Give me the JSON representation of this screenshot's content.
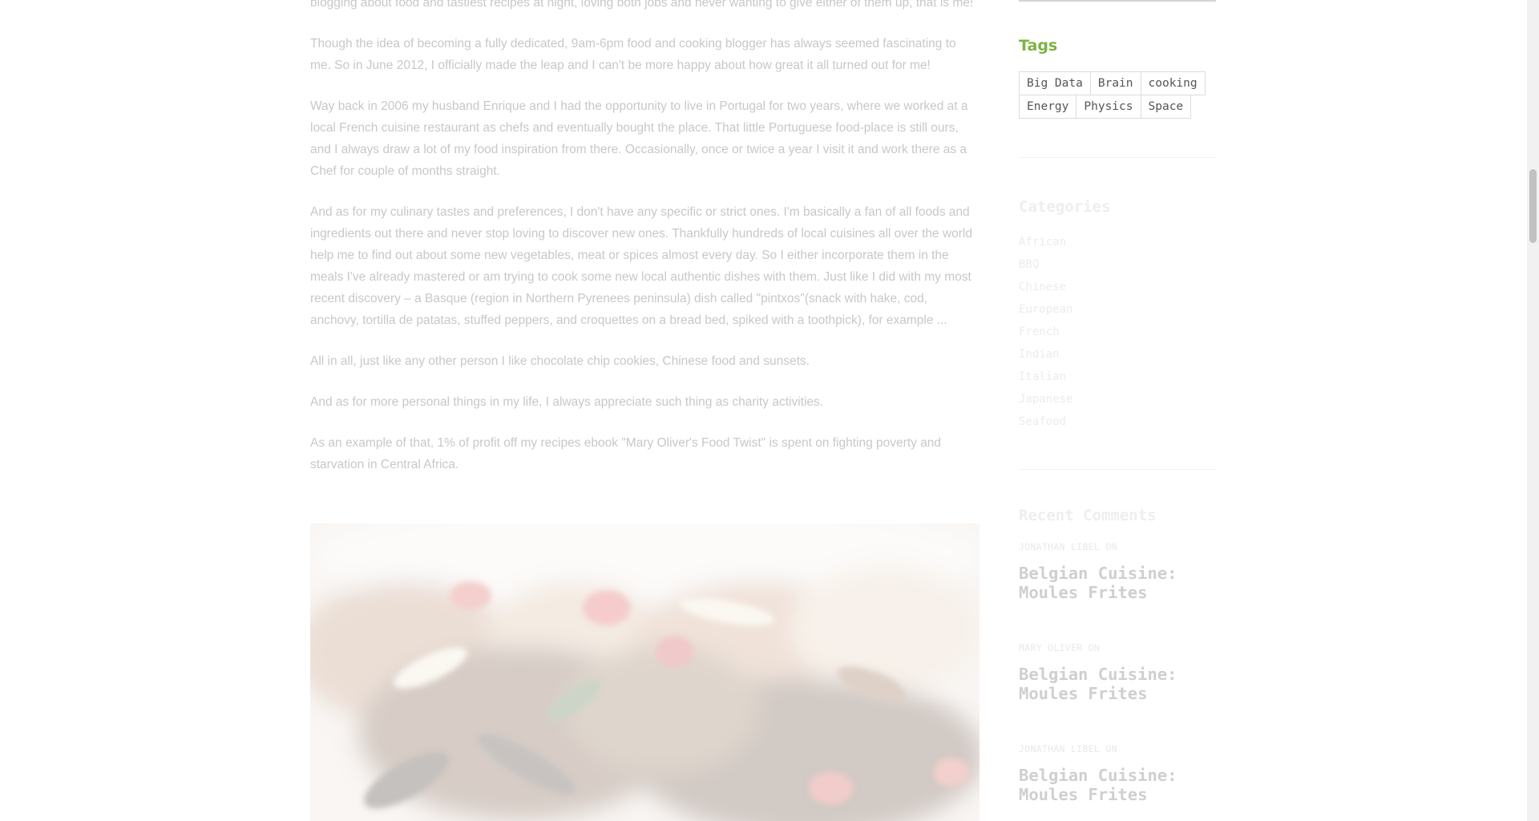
{
  "article": {
    "paragraphs": [
      "blogging about food and tastiest recipes at night, loving both jobs and never wanting to give either of them up, that is me!",
      "Though the idea of becoming a fully dedicated, 9am-6pm food and cooking blogger has always seemed fascinating to me. So in June 2012, I officially made the leap and I can't be more happy about how great it all turned out for me!",
      "Way back in 2006 my husband Enrique and I had the opportunity to live in Portugal for two years, where we worked at a local French cuisine restaurant as chefs and eventually bought the place. That little Portuguese food-place is still ours, and I always draw a lot of my food inspiration from there. Occasionally, once or twice a year I visit it and work there as a Chef for couple of months straight.",
      "And as for my culinary tastes and preferences, I don't have any specific or strict ones. I'm basically a fan of all foods and ingredients out there and never stop loving to discover new ones. Thankfully hundreds of local cuisines all over the world help me to find out about some new vegetables, meat or spices almost every day. So I either incorporate them in the meals I've already mastered or am trying to cook some new local authentic dishes with them. Just like I did with my most recent discovery – a Basque (region in Northern Pyrenees peninsula) dish called \"pintxos\"(snack with hake, cod, anchovy, tortilla de patatas, stuffed peppers, and croquettes on a bread bed, spiked with a toothpick), for example ...",
      "All in all, just like any other person I like chocolate chip cookies, Chinese food and sunsets.",
      "And as for more personal things in my life, I always appreciate such thing as charity activities.",
      "As an example of that, 1% of profit off my recipes ebook \"Mary Oliver's Food Twist\" is spent on fighting poverty and starvation in Central Africa."
    ],
    "image_name": "food-photo"
  },
  "sidebar": {
    "tags_title": "Tags",
    "tags": [
      "Big Data",
      "Brain",
      "cooking",
      "Energy",
      "Physics",
      "Space"
    ],
    "categories_title": "Categories",
    "categories": [
      "African",
      "BBQ",
      "Chinese",
      "European",
      "French",
      "Indian",
      "Italian",
      "Japanese",
      "Seafood"
    ],
    "recent_comments_title": "Recent Comments",
    "recent_comments": [
      {
        "author": "Jonathan Libel on",
        "post": "Belgian Cuisine: Moules Frites"
      },
      {
        "author": "Mary Oliver on",
        "post": "Belgian Cuisine: Moules Frites"
      },
      {
        "author": "Jonathan Libel on",
        "post": "Belgian Cuisine: Moules Frites"
      }
    ]
  },
  "colors": {
    "accent": "#7cb342",
    "body_text": "#c8c8c8"
  }
}
